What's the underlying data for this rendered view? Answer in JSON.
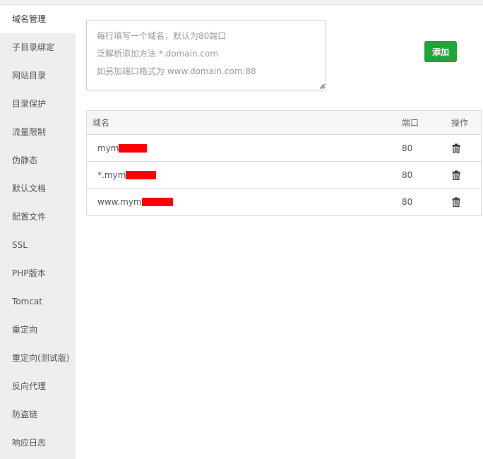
{
  "sidebar": {
    "items": [
      {
        "label": "域名管理",
        "active": true
      },
      {
        "label": "子目录绑定"
      },
      {
        "label": "网站目录"
      },
      {
        "label": "目录保护"
      },
      {
        "label": "流量限制"
      },
      {
        "label": "伪静态"
      },
      {
        "label": "默认文档"
      },
      {
        "label": "配置文件"
      },
      {
        "label": "SSL"
      },
      {
        "label": "PHP版本"
      },
      {
        "label": "Tomcat"
      },
      {
        "label": "重定向"
      },
      {
        "label": "重定向(测试版)"
      },
      {
        "label": "反向代理"
      },
      {
        "label": "防盗链"
      },
      {
        "label": "响应日志"
      }
    ]
  },
  "domain_input": {
    "value": "",
    "placeholder_lines": [
      "每行填写一个域名，默认为80端口",
      "泛解析添加方法 *.domain.com",
      "如另加端口格式为 www.domain.com:88"
    ]
  },
  "add_button": {
    "label": "添加",
    "color": "#20a53a"
  },
  "table": {
    "headers": {
      "domain": "域名",
      "port": "端口",
      "action": "操作"
    },
    "rows": [
      {
        "domain": "mym",
        "port": "80",
        "action_icon": "trash-icon"
      },
      {
        "domain": "*.mym",
        "port": "80",
        "action_icon": "trash-icon"
      },
      {
        "domain": "www.mym",
        "port": "80",
        "action_icon": "trash-icon"
      }
    ]
  },
  "colors": {
    "sidebar_bg": "#eeeef0",
    "primary_green": "#20a53a",
    "redaction": "#ff0000"
  }
}
